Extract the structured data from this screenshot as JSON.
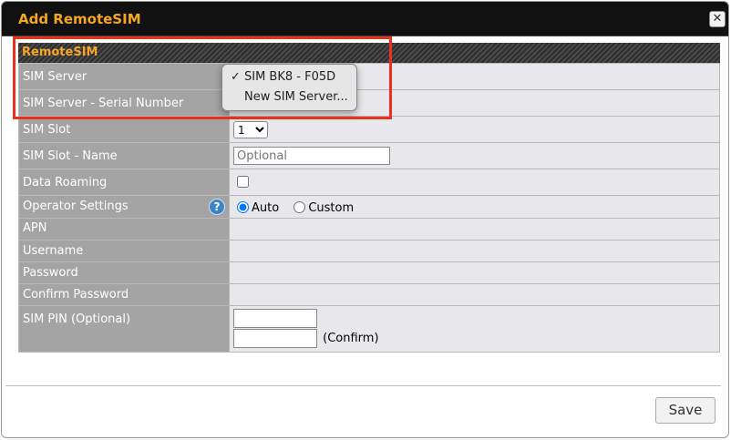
{
  "dialog": {
    "title": "Add RemoteSIM",
    "close_glyph": "✕"
  },
  "section": {
    "title": "RemoteSIM"
  },
  "rows": {
    "sim_server": {
      "label": "SIM Server"
    },
    "serial": {
      "label": "SIM Server - Serial Number"
    },
    "slot": {
      "label": "SIM Slot",
      "selected": "1"
    },
    "slot_name": {
      "label": "SIM Slot - Name",
      "placeholder": "Optional"
    },
    "roaming": {
      "label": "Data Roaming"
    },
    "operator": {
      "label": "Operator Settings",
      "options": [
        "Auto",
        "Custom"
      ],
      "selected": "Auto",
      "help_glyph": "?"
    },
    "apn": {
      "label": "APN"
    },
    "username": {
      "label": "Username"
    },
    "password": {
      "label": "Password"
    },
    "confirm": {
      "label": "Confirm Password"
    },
    "pin": {
      "label": "SIM PIN (Optional)",
      "confirm_label": "(Confirm)"
    }
  },
  "dropdown": {
    "items": [
      {
        "label": "SIM BK8 - F05D",
        "checked": true,
        "check_glyph": "✓"
      },
      {
        "label": "New SIM Server...",
        "checked": false
      }
    ]
  },
  "footer": {
    "save_label": "Save"
  },
  "colors": {
    "title_accent": "#f5a623",
    "label_bg": "#a4a4a4",
    "value_bg": "#e8e8ec",
    "highlight_border": "#e8301c"
  }
}
